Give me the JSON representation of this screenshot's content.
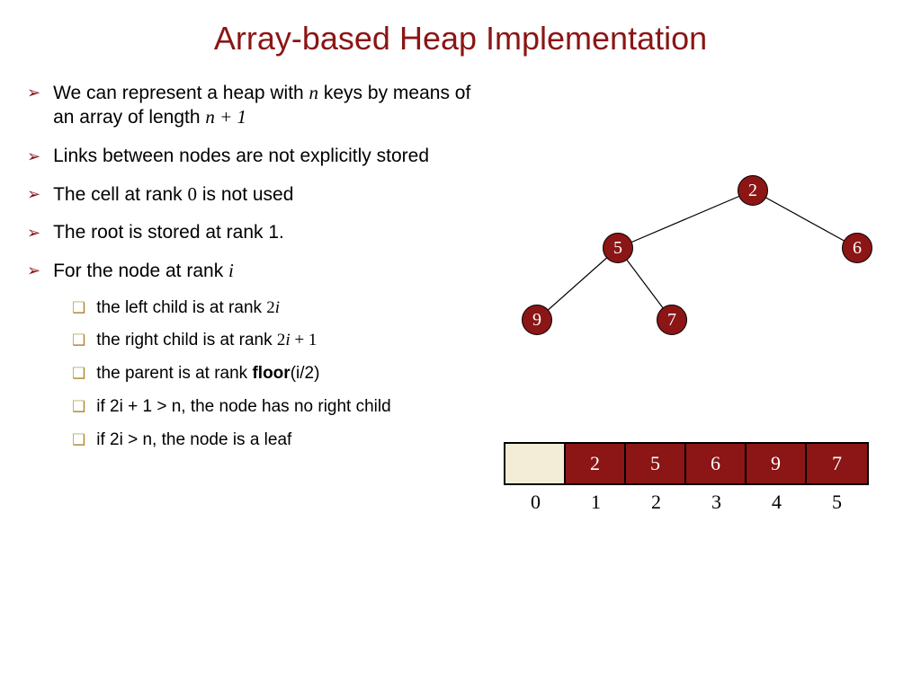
{
  "title": "Array-based Heap Implementation",
  "bullets": {
    "b0_pre": "We can represent a heap with ",
    "b0_n": "n",
    "b0_mid": " keys by means of an array of length ",
    "b0_expr": "n + 1",
    "b1": "Links between nodes are not explicitly stored",
    "b2_pre": "The cell at rank ",
    "b2_zero": "0",
    "b2_post": " is not used",
    "b3": "The root is stored at rank 1.",
    "b4_pre": "For the node at rank ",
    "b4_i": "i"
  },
  "sub": {
    "s0_pre": "the left child is at rank ",
    "s0_expr": "2i",
    "s1_pre": "the right child is at rank ",
    "s1_expr": "2i + 1",
    "s2_pre": "the parent is at rank ",
    "s2_bold": "floor",
    "s2_post": "(i/2)",
    "s3": "if 2i + 1 > n, the node has no right child",
    "s4": "if 2i > n, the node is a leaf"
  },
  "tree": {
    "n0": "2",
    "n1": "5",
    "n2": "6",
    "n3": "9",
    "n4": "7"
  },
  "array": {
    "cells": {
      "c1": "2",
      "c2": "5",
      "c3": "6",
      "c4": "9",
      "c5": "7"
    },
    "idx": {
      "i0": "0",
      "i1": "1",
      "i2": "2",
      "i3": "3",
      "i4": "4",
      "i5": "5"
    }
  },
  "chart_data": {
    "type": "table",
    "title": "Array-based Heap Implementation",
    "heap_tree": {
      "root": 2,
      "edges": [
        [
          2,
          5
        ],
        [
          2,
          6
        ],
        [
          5,
          9
        ],
        [
          5,
          7
        ]
      ],
      "nodes": [
        2,
        5,
        6,
        9,
        7
      ]
    },
    "array_representation": {
      "index": [
        0,
        1,
        2,
        3,
        4,
        5
      ],
      "value": [
        null,
        2,
        5,
        6,
        9,
        7
      ]
    }
  }
}
